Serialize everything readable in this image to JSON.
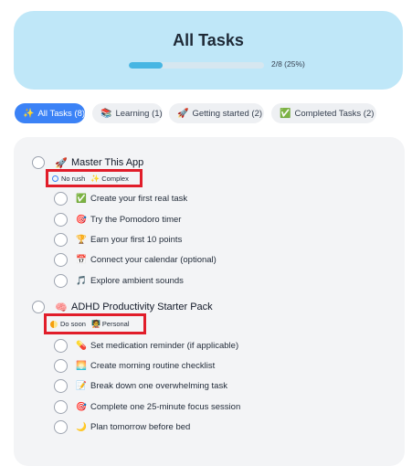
{
  "header": {
    "title": "All Tasks",
    "progress_text": "2/8 (25%)",
    "progress_fraction": 0.25
  },
  "tabs": [
    {
      "icon": "✨",
      "label": "All Tasks (8)",
      "active": true
    },
    {
      "icon": "📚",
      "label": "Learning (1)",
      "active": false
    },
    {
      "icon": "🚀",
      "label": "Getting started (2)",
      "active": false
    },
    {
      "icon": "✅",
      "label": "Completed Tasks (2)",
      "active": false
    }
  ],
  "groups": [
    {
      "emoji": "🚀",
      "title": "Master This App",
      "tags": [
        {
          "icon": "ring",
          "label": "No rush"
        },
        {
          "icon": "✨",
          "label": "Complex"
        }
      ],
      "tasks": [
        {
          "emoji": "✅",
          "label": "Create your first real task"
        },
        {
          "emoji": "🎯",
          "label": "Try the Pomodoro timer"
        },
        {
          "emoji": "🏆",
          "label": "Earn your first 10 points"
        },
        {
          "emoji": "📅",
          "label": "Connect your calendar (optional)"
        },
        {
          "emoji": "🎵",
          "label": "Explore ambient sounds"
        }
      ]
    },
    {
      "emoji": "🧠",
      "title": "ADHD Productivity Starter Pack",
      "tags": [
        {
          "icon": "half",
          "label": "Do soon"
        },
        {
          "icon": "🧑‍🏫",
          "label": "Personal"
        }
      ],
      "tasks": [
        {
          "emoji": "💊",
          "label": "Set medication reminder (if applicable)"
        },
        {
          "emoji": "🌅",
          "label": "Create morning routine checklist"
        },
        {
          "emoji": "📝",
          "label": "Break down one overwhelming task"
        },
        {
          "emoji": "🎯",
          "label": "Complete one 25-minute focus session"
        },
        {
          "emoji": "🌙",
          "label": "Plan tomorrow before bed"
        }
      ]
    }
  ]
}
